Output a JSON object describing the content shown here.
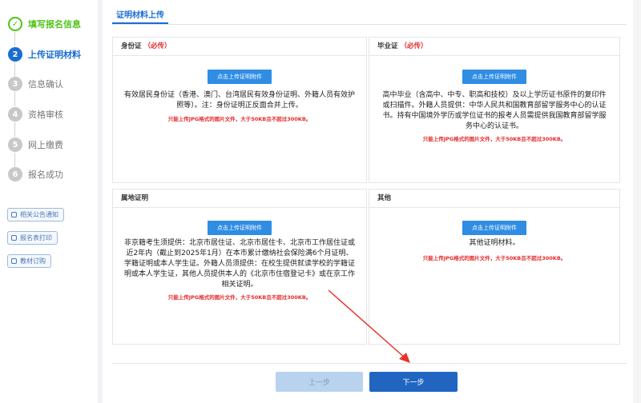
{
  "steps": [
    {
      "num": "✓",
      "label": "填写报名信息",
      "state": "done"
    },
    {
      "num": "2",
      "label": "上传证明材料",
      "state": "active"
    },
    {
      "num": "3",
      "label": "信息确认",
      "state": "todo"
    },
    {
      "num": "4",
      "label": "资格审核",
      "state": "todo"
    },
    {
      "num": "5",
      "label": "网上缴费",
      "state": "todo"
    },
    {
      "num": "6",
      "label": "报名成功",
      "state": "todo"
    }
  ],
  "side_links": [
    "相关公告通知",
    "报名表打印",
    "教材订购"
  ],
  "tab": "证明材料上传",
  "upload_label": "点击上传证明附件",
  "warn": "只能上传JPG格式的图片文件，大于50KB且不超过300KB。",
  "cards": [
    {
      "title": "身份证",
      "required": "（必传）",
      "desc": "有效居民身份证（香港、澳门、台湾居民有效身份证明、外籍人员有效护照等）。注：身份证明正反面合并上传。"
    },
    {
      "title": "毕业证",
      "required": "（必传）",
      "desc": "高中毕业（含高中、中专、职高和技校）及以上学历证书原件的复印件或扫描件。外籍人员提供：中华人民共和国教育部留学服务中心的认证书。持有中国境外学历或学位证书的报考人员需提供我国教育部留学服务中心的认证书。"
    },
    {
      "title": "属地证明",
      "required": "",
      "desc": "非京籍考生须提供：北京市居住证、北京市居住卡、北京市工作居住证或近2年内（截止到2025年1月）在本市累计缴纳社会保险满6个月证明、学籍证明或本人学生证。外籍人员须提供：在校生提供就读学校的学籍证明或本人学生证，其他人员提供本人的《北京市住宿登记卡》或在京工作相关证明。"
    },
    {
      "title": "其他",
      "required": "",
      "desc": "其他证明材料。"
    }
  ],
  "prev_label": "上一步",
  "next_label": "下一步",
  "colors": {
    "primary": "#1a6dd1",
    "done": "#52c41a",
    "warn": "#e52a2a",
    "arrow": "#e8342a"
  }
}
